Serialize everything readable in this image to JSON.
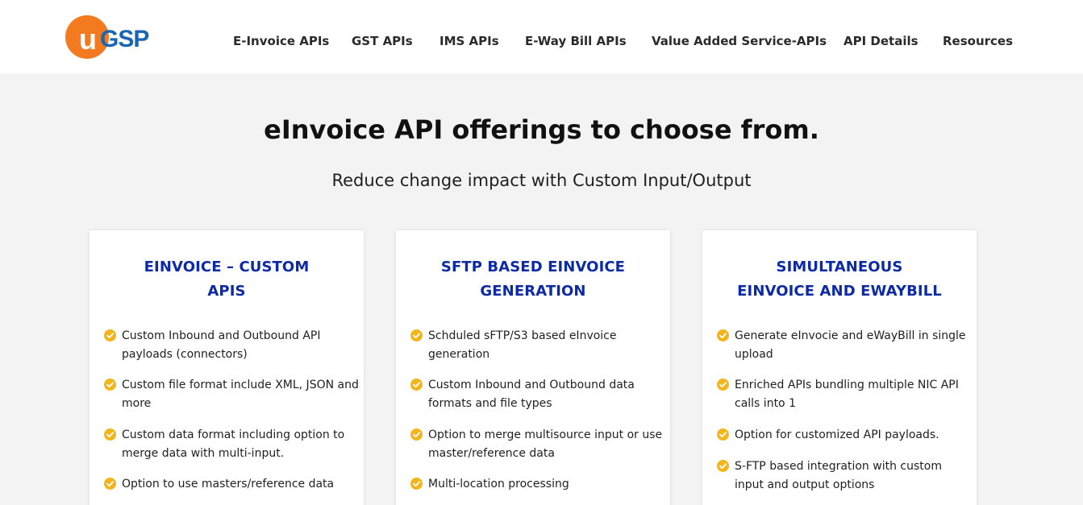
{
  "brand": {
    "logo_u": "u",
    "logo_text": "GSP",
    "colors": {
      "orange": "#f47a20",
      "blue": "#1865b3"
    }
  },
  "nav": {
    "items": [
      {
        "label": "E-Invoice APIs"
      },
      {
        "label": "GST APIs"
      },
      {
        "label": "IMS APIs"
      },
      {
        "label": "E-Way Bill APIs"
      },
      {
        "label": "Value Added Service-APIs"
      },
      {
        "label": "API Details"
      },
      {
        "label": "Resources"
      }
    ]
  },
  "hero": {
    "title": "eInvoice API offerings to choose from.",
    "subtitle": "Reduce change impact with Custom Input/Output"
  },
  "accent_colors": {
    "title_blue": "#0d2aa5",
    "check_yellow": "#f2b51c"
  },
  "cards": [
    {
      "title_lines": [
        "EINVOICE – CUSTOM",
        "APIS"
      ],
      "features": [
        {
          "lines": [
            "Custom Inbound and Outbound API",
            "payloads (connectors)"
          ]
        },
        {
          "lines": [
            "Custom file format include XML, JSON and",
            "more"
          ]
        },
        {
          "lines": [
            "Custom data format including option to",
            "merge data with multi-input."
          ]
        },
        {
          "lines": [
            "Option to use masters/reference data"
          ]
        }
      ]
    },
    {
      "title_lines": [
        "SFTP BASED EINVOICE",
        "GENERATION"
      ],
      "features": [
        {
          "lines": [
            "Schduled sFTP/S3 based eInvoice",
            "generation"
          ]
        },
        {
          "lines": [
            "Custom Inbound and Outbound data",
            "formats and file types"
          ]
        },
        {
          "lines": [
            "Option to merge multisource input or use",
            "master/reference data"
          ]
        },
        {
          "lines": [
            "Multi-location processing"
          ]
        }
      ]
    },
    {
      "title_lines": [
        "SIMULTANEOUS",
        "EINVOICE AND EWAYBILL"
      ],
      "features": [
        {
          "lines": [
            "Generate eInvocie and eWayBill in single",
            "upload"
          ]
        },
        {
          "lines": [
            "Enriched APIs bundling multiple NIC API",
            "calls into 1"
          ]
        },
        {
          "lines": [
            "Option for customized API payloads."
          ]
        },
        {
          "lines": [
            "S-FTP based integration with custom",
            "input and output options"
          ]
        }
      ]
    }
  ]
}
